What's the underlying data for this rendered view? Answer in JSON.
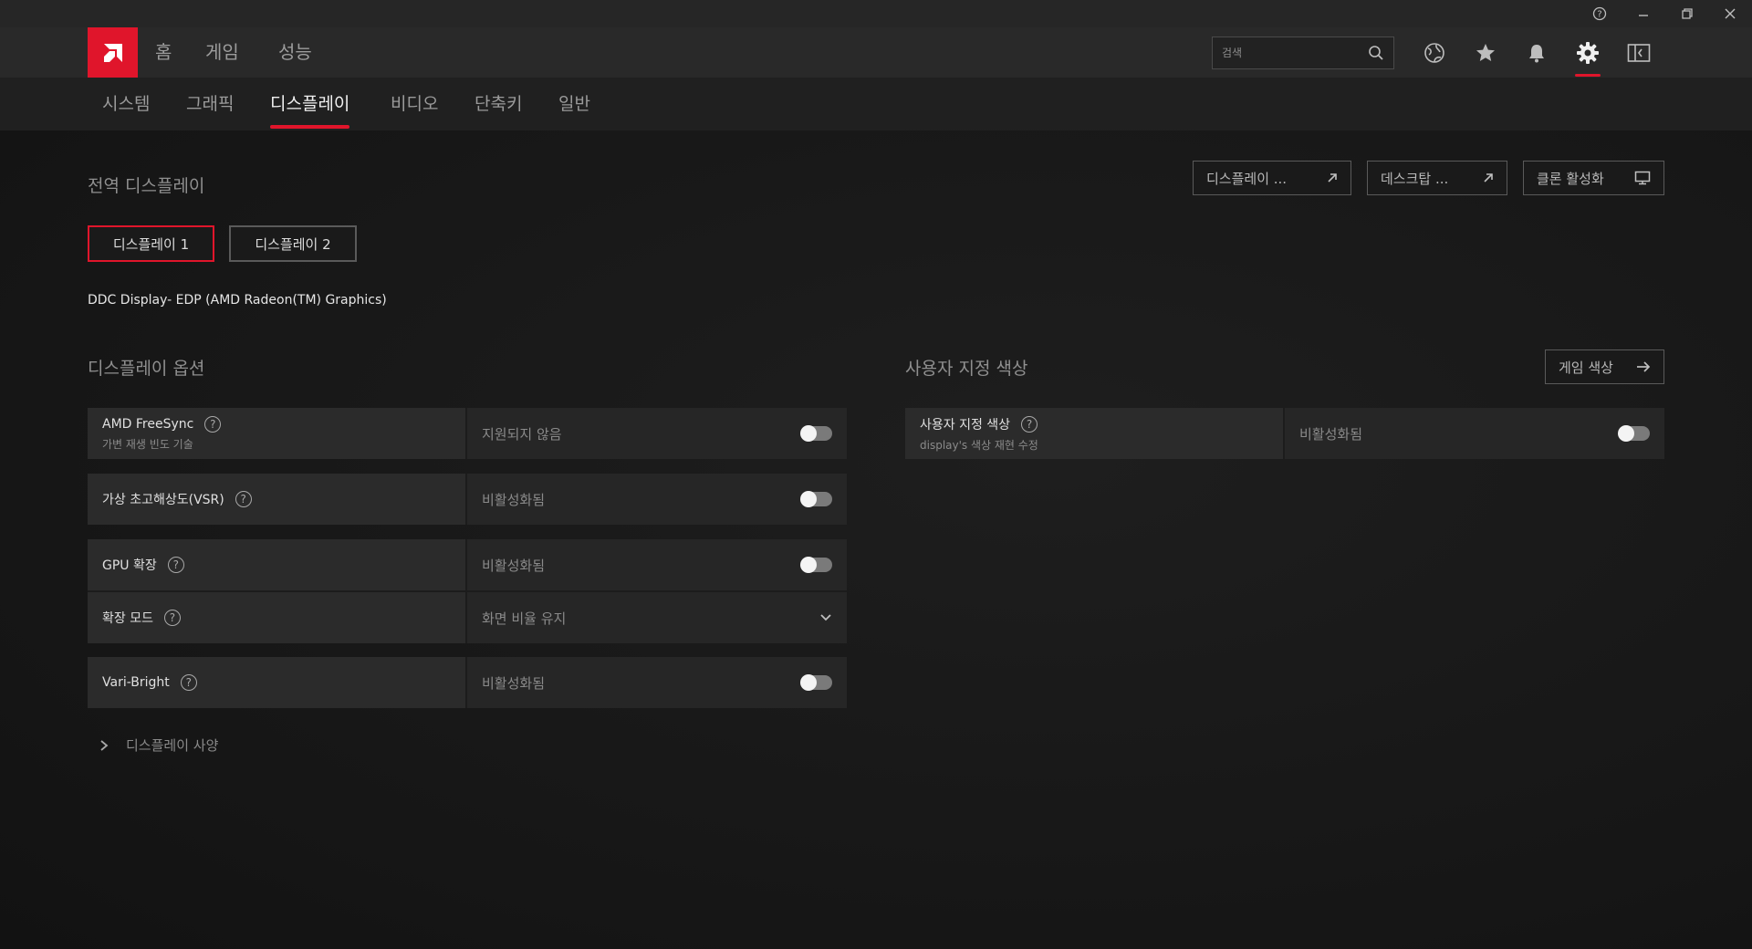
{
  "window": {
    "controls": {
      "help": "?",
      "minimize": "–",
      "restore": "❐",
      "close": "✕"
    }
  },
  "nav": {
    "items": [
      {
        "label": "홈"
      },
      {
        "label": "게임"
      },
      {
        "label": "성능"
      }
    ],
    "search_placeholder": "검색",
    "accent_color": "#e0152b"
  },
  "subnav": {
    "tabs": [
      {
        "label": "시스템"
      },
      {
        "label": "그래픽"
      },
      {
        "label": "디스플레이",
        "active": true
      },
      {
        "label": "비디오"
      },
      {
        "label": "단축키"
      },
      {
        "label": "일반"
      }
    ]
  },
  "main": {
    "global_title": "전역 디스플레이",
    "top_buttons": [
      {
        "label": "디스플레이 ..."
      },
      {
        "label": "데스크탑 ..."
      },
      {
        "label": "클론 활성화"
      }
    ],
    "display_buttons": [
      {
        "label": "디스플레이 1",
        "active": true
      },
      {
        "label": "디스플레이 2"
      }
    ],
    "display_name": "DDC Display- EDP (AMD Radeon(TM) Graphics)",
    "options_title": "디스플레이 옵션",
    "options": [
      {
        "label": "AMD FreeSync",
        "sub": "가변 재생 빈도 기술",
        "value": "지원되지 않음",
        "control": "toggle"
      },
      {
        "label": "가상 초고해상도(VSR)",
        "value": "비활성화됨",
        "control": "toggle"
      },
      {
        "label": "GPU 확장",
        "value": "비활성화됨",
        "control": "toggle"
      },
      {
        "label": "확장 모드",
        "value": "화면 비율 유지",
        "control": "dropdown"
      },
      {
        "label": "Vari-Bright",
        "value": "비활성화됨",
        "control": "toggle"
      }
    ],
    "specs_label": "디스플레이 사양",
    "custom_color_title": "사용자 지정 색상",
    "game_color_button": "게임 색상",
    "custom_color": {
      "label": "사용자 지정 색상",
      "sub": "display's 색상 재현 수정",
      "value": "비활성화됨"
    }
  }
}
